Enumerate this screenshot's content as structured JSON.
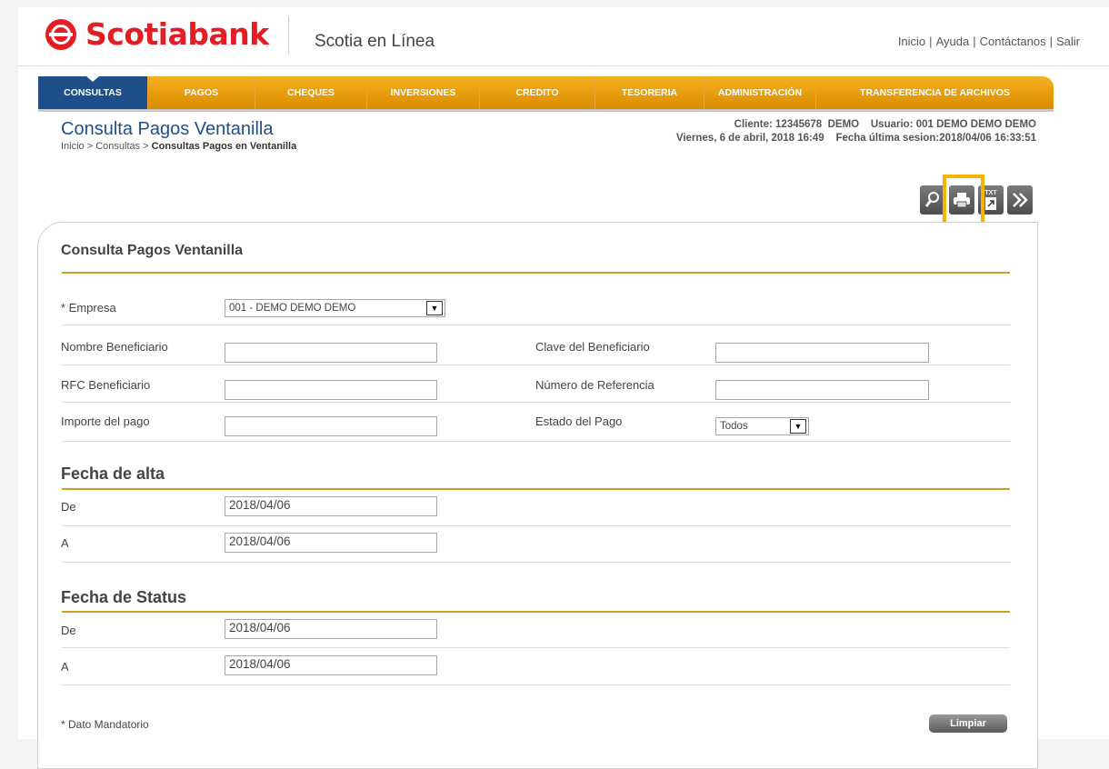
{
  "header": {
    "brand": "Scotiabank",
    "app_name": "Scotia en Línea",
    "links": [
      "Inicio",
      "Ayuda",
      "Contáctanos",
      "Salir"
    ],
    "separator": "|"
  },
  "nav": {
    "items": [
      "CONSULTAS",
      "PAGOS",
      "CHEQUES",
      "INVERSIONES",
      "CREDITO",
      "TESORERIA",
      "ADMINISTRACIÓN",
      "TRANSFERENCIA DE ARCHIVOS"
    ],
    "active": "CONSULTAS"
  },
  "page": {
    "title": "Consulta Pagos Ventanilla",
    "breadcrumb_prefix": "Inicio > Consultas > ",
    "breadcrumb_current": "Consultas Pagos en Ventanilla",
    "client_line": "Cliente: 12345678  DEMO    Usuario: 001 DEMO DEMO DEMO",
    "date_line": "Viernes, 6 de abril, 2018 16:49    Fecha última sesion:2018/04/06 16:33:51"
  },
  "toolbar": {
    "icons": [
      "search-icon",
      "print-icon",
      "txt-export-icon",
      "next-icon"
    ],
    "txt_label": "TXT"
  },
  "form": {
    "panel_title": "Consulta Pagos Ventanilla",
    "empresa_label": "* Empresa",
    "empresa_value": "001 - DEMO DEMO DEMO",
    "nombre_label": "Nombre Beneficiario",
    "clave_label": "Clave del Beneficiario",
    "rfc_label": "RFC Beneficiario",
    "referencia_label": "Número de Referencia",
    "importe_label": "Importe del pago",
    "estado_label": "Estado del Pago",
    "estado_value": "Todos",
    "fecha_alta_title": "Fecha de alta",
    "fecha_status_title": "Fecha de Status",
    "de_label": "De",
    "a_label": "A",
    "alta_de": "2018/04/06",
    "alta_a": "2018/04/06",
    "status_de": "2018/04/06",
    "status_a": "2018/04/06",
    "mandatory_note": "* Dato Mandatorio",
    "clear_button": "Limpiar"
  },
  "colors": {
    "brand_red": "#e41c23",
    "nav_gold": "#f4b11f",
    "nav_active": "#1f4f8b",
    "highlight": "#f5b300"
  }
}
